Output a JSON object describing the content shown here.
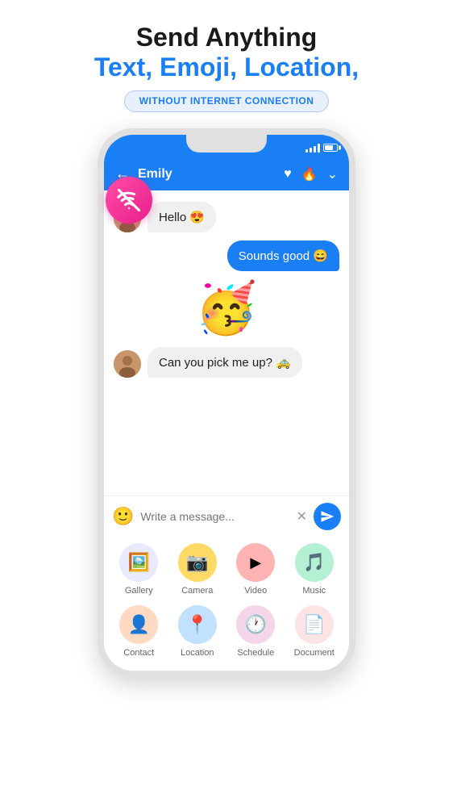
{
  "headline": {
    "line1": "Send Anything",
    "line2": "Text, Emoji, Location,",
    "badge": "WITHOUT INTERNET CONNECTION"
  },
  "phone": {
    "contact_name": "Emily",
    "messages": [
      {
        "type": "received",
        "text": "Hello 😍",
        "avatar": "👩"
      },
      {
        "type": "sent",
        "text": "Sounds good 😄"
      },
      {
        "type": "sticker",
        "emoji": "🎉😁"
      },
      {
        "type": "received",
        "text": "Can you pick me up? 🚕",
        "avatar": "👩"
      }
    ],
    "input_placeholder": "Write a message...",
    "actions": [
      {
        "id": "gallery",
        "label": "Gallery",
        "icon": "🖼️",
        "color_class": "ic-gallery"
      },
      {
        "id": "camera",
        "label": "Camera",
        "icon": "📷",
        "color_class": "ic-camera"
      },
      {
        "id": "video",
        "label": "Video",
        "icon": "▶️",
        "color_class": "ic-video"
      },
      {
        "id": "music",
        "label": "Music",
        "icon": "🎵",
        "color_class": "ic-music"
      },
      {
        "id": "contact",
        "label": "Contact",
        "icon": "👤",
        "color_class": "ic-contact"
      },
      {
        "id": "location",
        "label": "Location",
        "icon": "📍",
        "color_class": "ic-location"
      },
      {
        "id": "schedule",
        "label": "Schedule",
        "icon": "🕐",
        "color_class": "ic-schedule"
      },
      {
        "id": "document",
        "label": "Document",
        "icon": "📄",
        "color_class": "ic-document"
      }
    ]
  },
  "colors": {
    "blue": "#1a7ef5",
    "pink": "#e91e8c"
  }
}
